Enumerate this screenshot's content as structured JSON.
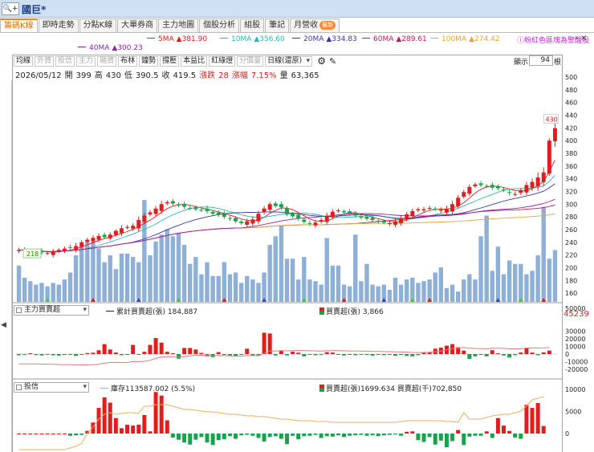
{
  "app": {
    "search_icon_label": "🔍+",
    "stock_title": "國巨*"
  },
  "tabs": [
    {
      "label": "籌碼K線",
      "active": true
    },
    {
      "label": "即時走勢",
      "active": false
    },
    {
      "label": "分點K線",
      "active": false
    },
    {
      "label": "大單券商",
      "active": false
    },
    {
      "label": "主力地圖",
      "active": false
    },
    {
      "label": "個股分析",
      "active": false
    },
    {
      "label": "組股",
      "active": false
    },
    {
      "label": "筆記",
      "active": false
    },
    {
      "label": "月營收",
      "active": false,
      "badge": "最新"
    }
  ],
  "ma_legend": [
    {
      "label": "5MA",
      "value": "▲381.90",
      "color": "#e11d1d"
    },
    {
      "label": "10MA",
      "value": "▲356.60",
      "color": "#2bb5b5"
    },
    {
      "label": "20MA",
      "value": "▲334.83",
      "color": "#3a3aa8"
    },
    {
      "label": "60MA",
      "value": "▲289.61",
      "color": "#c2185b"
    },
    {
      "label": "100MA",
      "value": "▲274.42",
      "color": "#e8a23a"
    },
    {
      "label": "40MA",
      "value": "▲300.23",
      "color": "#8e24aa"
    }
  ],
  "color_hint": "粉紅色區塊為警醒股",
  "window_icons": "–×",
  "toolbar": {
    "buttons": [
      {
        "label": "均線",
        "enabled": true
      },
      {
        "label": "外資",
        "enabled": false
      },
      {
        "label": "投信",
        "enabled": false
      },
      {
        "label": "主力",
        "enabled": false
      },
      {
        "label": "融資",
        "enabled": false
      },
      {
        "label": "布林",
        "enabled": true
      },
      {
        "label": "鐘勢",
        "enabled": true
      },
      {
        "label": "撐壓",
        "enabled": true
      },
      {
        "label": "本益比",
        "enabled": true
      },
      {
        "label": "紅綠燈",
        "enabled": true
      },
      {
        "label": "分價量",
        "enabled": false
      }
    ],
    "period_select": "日線(還原)",
    "gear_icon": "⚙",
    "pencil_icon": "✎",
    "display_label": "顯示:",
    "display_value": "94",
    "display_unit": "根"
  },
  "quote": {
    "date": "2026/05/12",
    "open_label": "開",
    "open": "399",
    "high_label": "高",
    "high": "430",
    "low_label": "低",
    "low": "390.5",
    "close_label": "收",
    "close": "419.5",
    "change_label": "漲跌",
    "change": "28",
    "pct_label": "漲幅",
    "pct": "7.15%",
    "vol_label": "量",
    "vol": "63,365"
  },
  "price_panel": {
    "high_marker": "430",
    "low_marker": "218",
    "y_ticks": [
      "500",
      "480",
      "460",
      "440",
      "420",
      "400",
      "380",
      "360",
      "340",
      "320",
      "300",
      "280",
      "260",
      "240",
      "220",
      "200",
      "180",
      "160"
    ]
  },
  "panel2": {
    "select": "主力買賣超",
    "legend_line": "累計買賣超(張)",
    "legend_line_value": "184,887",
    "legend_bar": "買賣超(張)",
    "legend_bar_value": "3,866",
    "current_value": "45239",
    "y_ticks": [
      "50000",
      "30000",
      "20000",
      "10000",
      "0",
      "-10000",
      "-20000"
    ]
  },
  "panel3": {
    "select": "投信",
    "legend_line": "庫存113587.002 (5.5%)",
    "legend_bar": "買賣超(張)1699.634 買賣超(千)702,850",
    "y_ticks": [
      "10000",
      "5000",
      "0"
    ]
  },
  "colors": {
    "up": "#e11d1d",
    "down": "#17a34a",
    "volume": "#8fb0d6"
  },
  "chart_data": {
    "type": "candlestick",
    "bars": 94,
    "closes": [
      228,
      227,
      226,
      225,
      224,
      223,
      225,
      228,
      230,
      232,
      234,
      240,
      244,
      247,
      250,
      248,
      252,
      258,
      262,
      264,
      266,
      275,
      282,
      287,
      293,
      300,
      303,
      301,
      298,
      296,
      294,
      292,
      290,
      289,
      285,
      283,
      280,
      277,
      273,
      270,
      273,
      276,
      285,
      293,
      300,
      297,
      295,
      284,
      281,
      277,
      272,
      269,
      271,
      275,
      282,
      288,
      290,
      287,
      285,
      282,
      279,
      277,
      275,
      272,
      271,
      270,
      273,
      278,
      284,
      289,
      292,
      292,
      294,
      292,
      291,
      292,
      300,
      310,
      319,
      327,
      331,
      330,
      328,
      326,
      325,
      322,
      318,
      316,
      322,
      330,
      335,
      342,
      350,
      400,
      419.5
    ],
    "price_ylim": [
      150,
      500
    ],
    "volume_ylim": [
      0,
      6
    ]
  }
}
